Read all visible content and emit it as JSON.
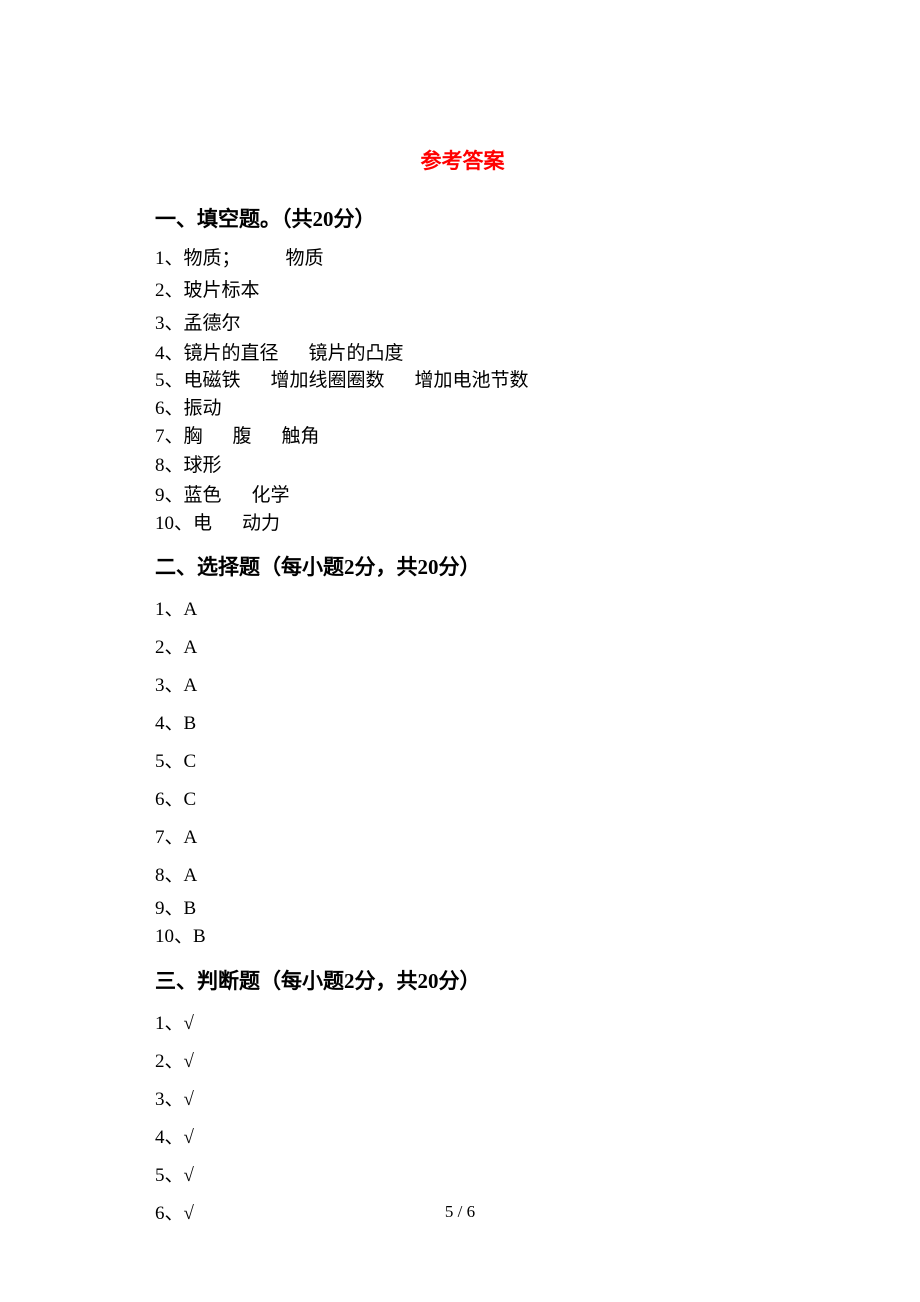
{
  "title": "参考答案",
  "sections": {
    "s1": {
      "header": "一、填空题。（共20分）",
      "answers": {
        "a1_pre": "1、物质；",
        "a1_post": "物质",
        "a2": "2、玻片标本",
        "a3": "3、孟德尔",
        "a4_pre": "4、镜片的直径",
        "a4_post": "镜片的凸度",
        "a5_1": "5、电磁铁",
        "a5_2": "增加线圈圈数",
        "a5_3": "增加电池节数",
        "a6": "6、振动",
        "a7_1": "7、胸",
        "a7_2": "腹",
        "a7_3": "触角",
        "a8": "8、球形",
        "a9_1": "9、蓝色",
        "a9_2": "化学",
        "a10_1": "10、电",
        "a10_2": "动力"
      }
    },
    "s2": {
      "header": "二、选择题（每小题2分，共20分）",
      "answers": {
        "a1": "1、A",
        "a2": "2、A",
        "a3": "3、A",
        "a4": "4、B",
        "a5": "5、C",
        "a6": "6、C",
        "a7": "7、A",
        "a8": "8、A",
        "a9": "9、B",
        "a10": "10、B"
      }
    },
    "s3": {
      "header": "三、判断题（每小题2分，共20分）",
      "answers": {
        "a1": "1、√",
        "a2": "2、√",
        "a3": "3、√",
        "a4": "4、√",
        "a5": "5、√",
        "a6": "6、√"
      }
    }
  },
  "page_number": "5 / 6"
}
